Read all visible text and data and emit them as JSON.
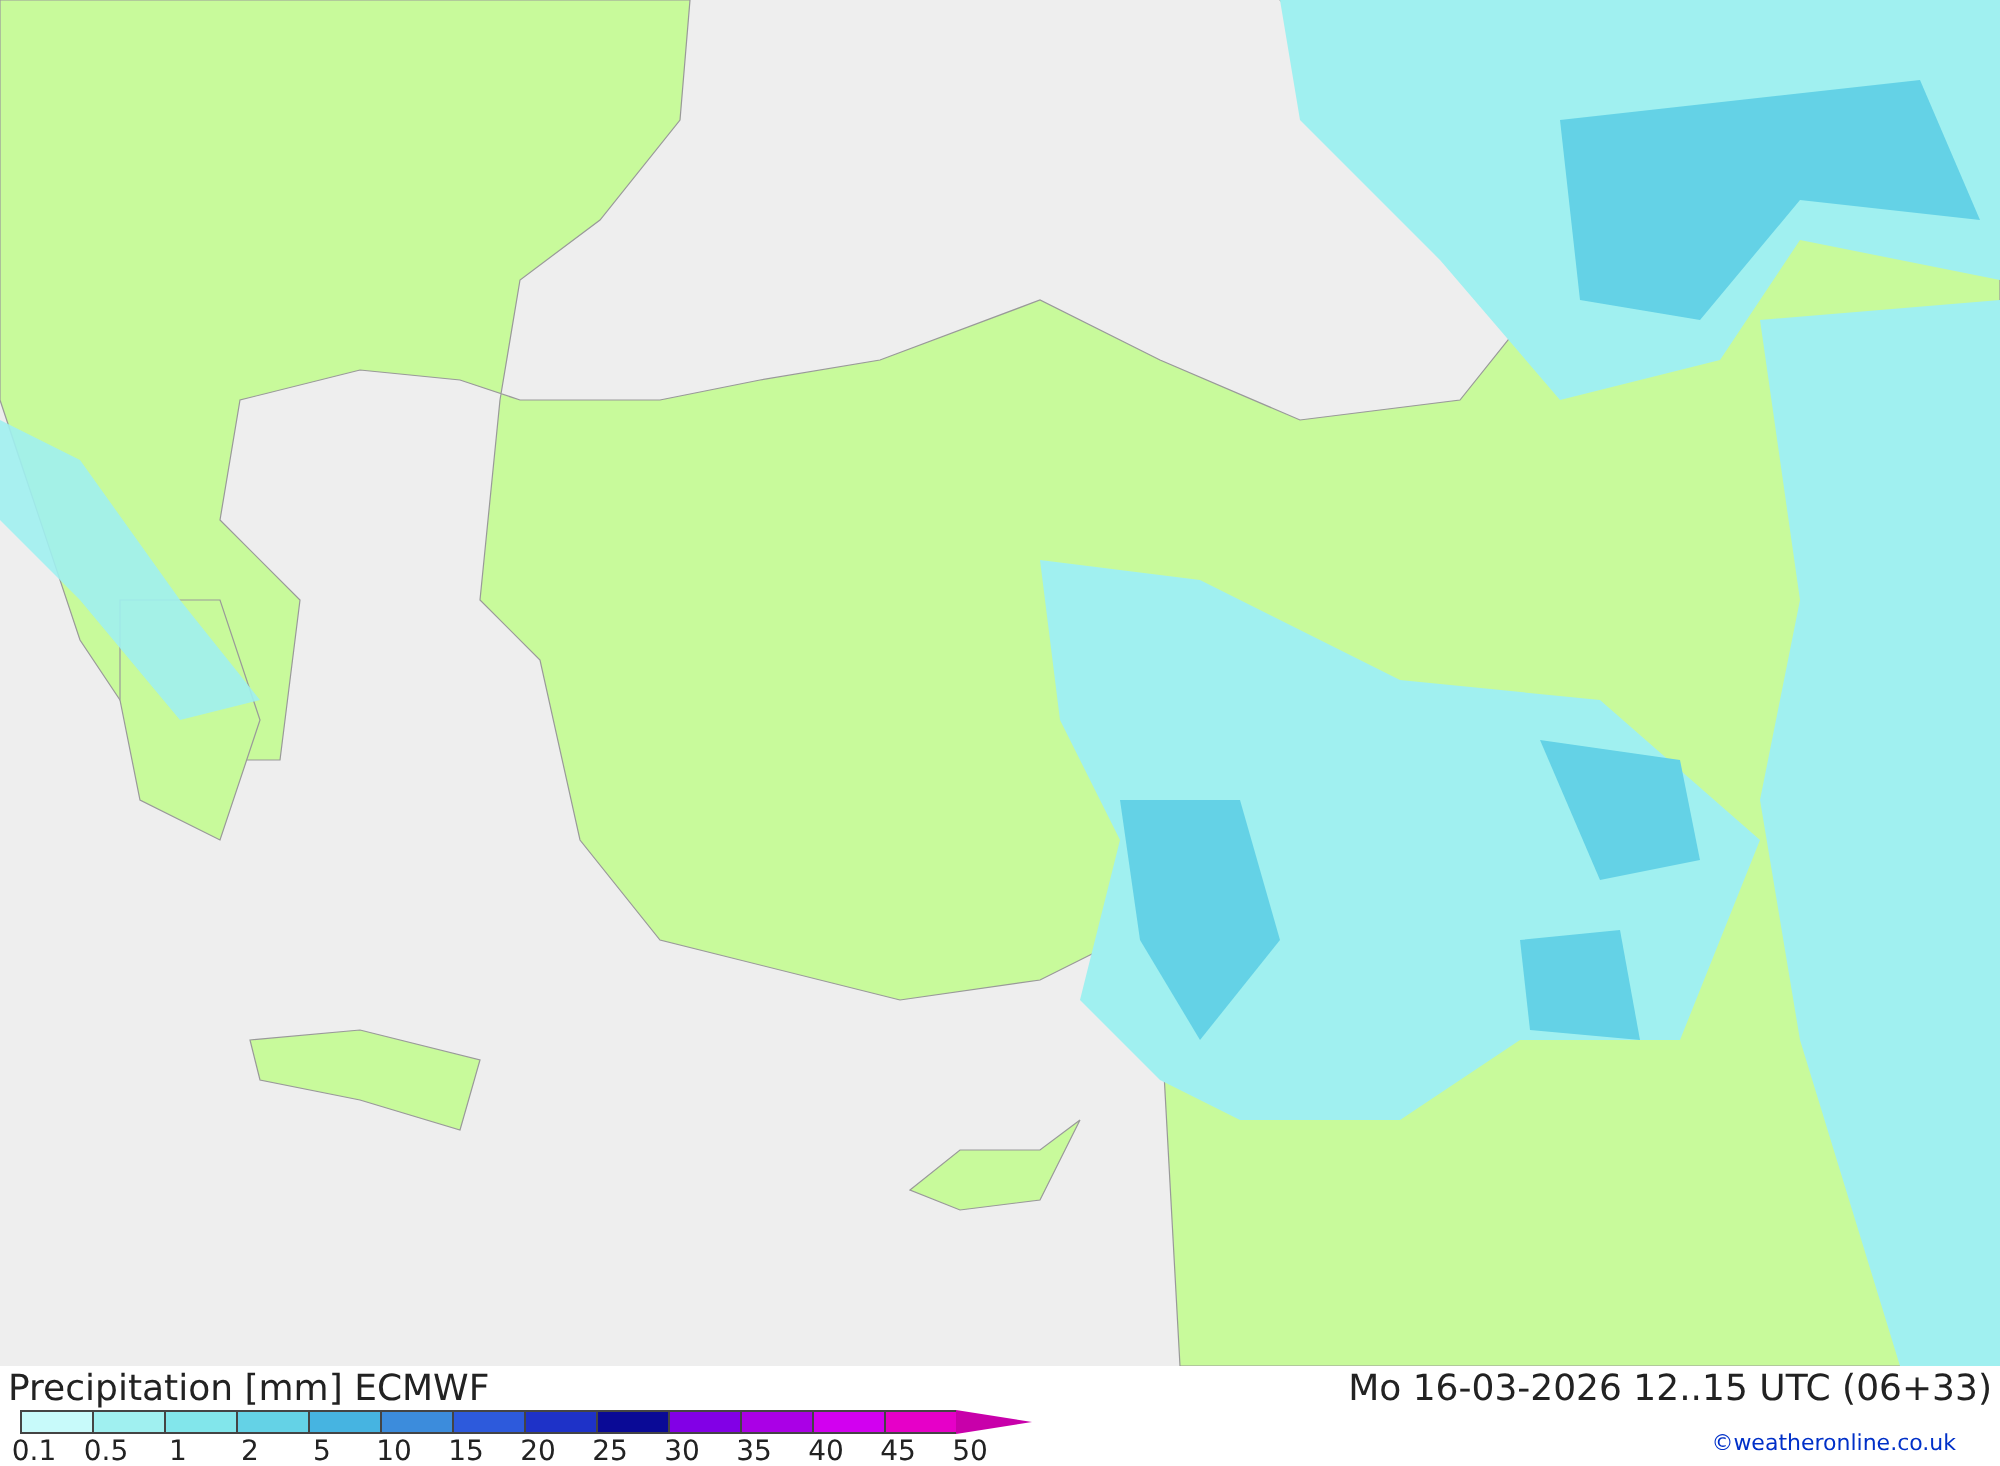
{
  "title": "Precipitation [mm] ECMWF",
  "valid_time": "Mo 16-03-2026 12..15 UTC (06+33)",
  "legend": [
    {
      "label": "0.1",
      "color": "#c8fafa"
    },
    {
      "label": "0.5",
      "color": "#a0f0f0"
    },
    {
      "label": "1",
      "color": "#82e6eb"
    },
    {
      "label": "2",
      "color": "#64d2e6"
    },
    {
      "label": "5",
      "color": "#46b4e1"
    },
    {
      "label": "10",
      "color": "#3c8cdc"
    },
    {
      "label": "15",
      "color": "#2d5adc"
    },
    {
      "label": "20",
      "color": "#1e32c8"
    },
    {
      "label": "25",
      "color": "#0a0a96"
    },
    {
      "label": "30",
      "color": "#8200e6"
    },
    {
      "label": "35",
      "color": "#aa00e6"
    },
    {
      "label": "40",
      "color": "#d200f0"
    },
    {
      "label": "45",
      "color": "#e600c8"
    },
    {
      "label": "50",
      "color": "#c800aa"
    }
  ],
  "credit": "©weatheronline.co.uk"
}
